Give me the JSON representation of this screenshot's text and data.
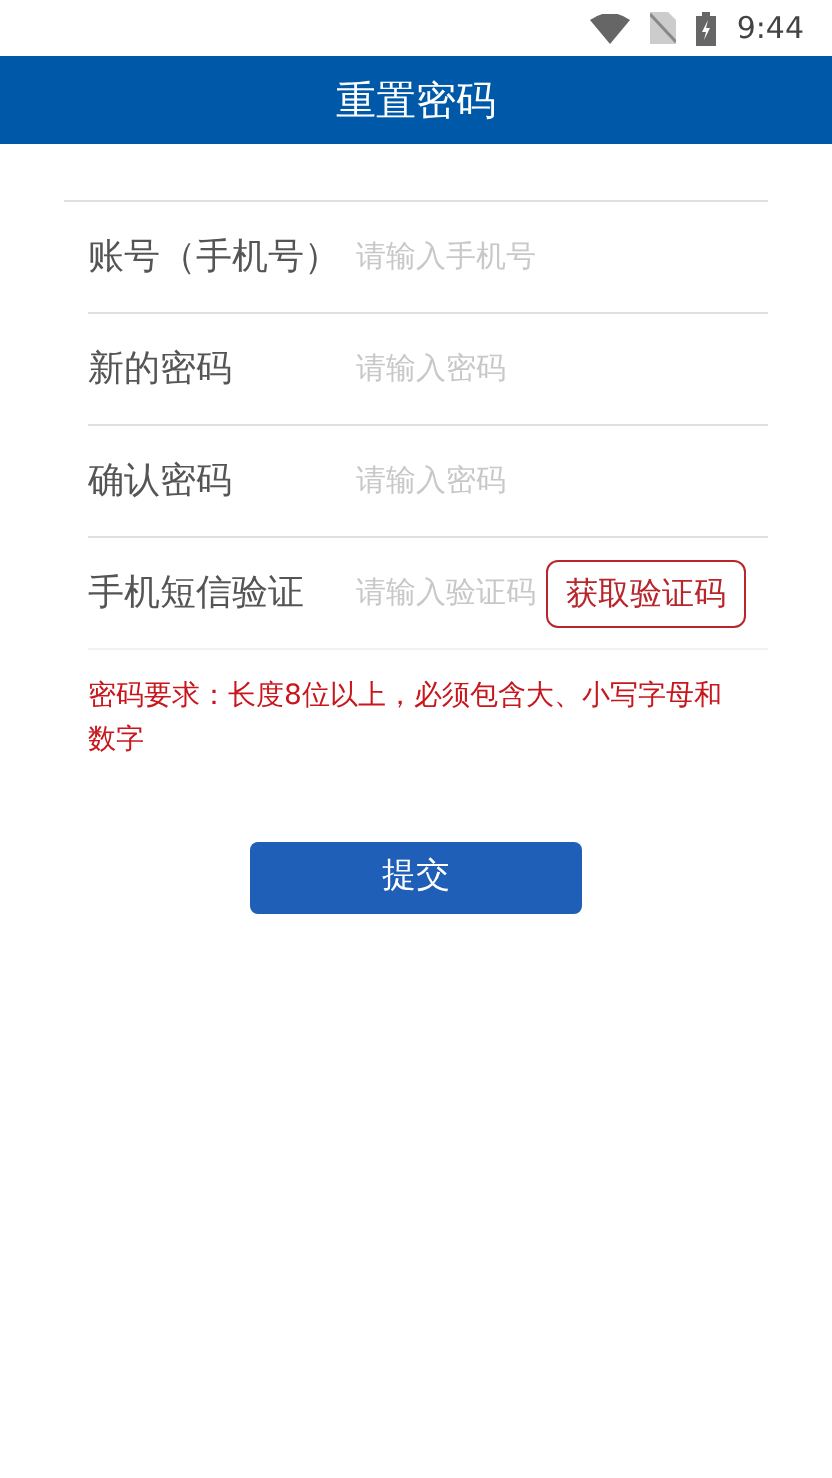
{
  "status_bar": {
    "time": "9:44"
  },
  "header": {
    "title": "重置密码"
  },
  "fields": [
    {
      "label": "账号（手机号）",
      "placeholder": "请输入手机号",
      "kind": "text"
    },
    {
      "label": "新的密码",
      "placeholder": "请输入密码",
      "kind": "text"
    },
    {
      "label": "确认密码",
      "placeholder": "请输入密码",
      "kind": "text"
    },
    {
      "label": "手机短信验证",
      "placeholder": "请输入验证码",
      "kind": "code",
      "button": "获取验证码"
    }
  ],
  "note": "密码要求：长度8位以上，必须包含大、小写字母和数字",
  "submit": "提交"
}
